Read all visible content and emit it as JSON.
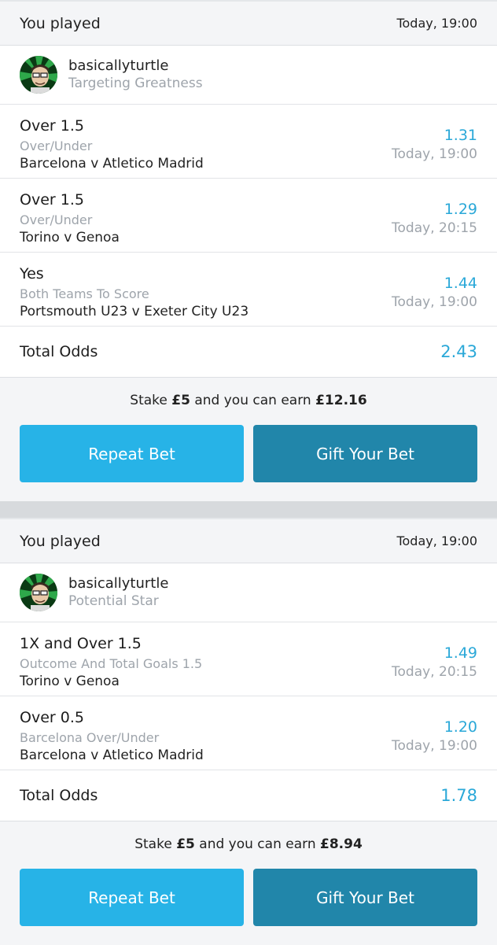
{
  "bets": [
    {
      "header": {
        "title": "You played",
        "time": "Today, 19:00"
      },
      "user": {
        "name": "basicallyturtle",
        "rank": "Targeting Greatness"
      },
      "selections": [
        {
          "pick": "Over 1.5",
          "market": "Over/Under",
          "event": "Barcelona v Atletico Madrid",
          "odds": "1.31",
          "time": "Today, 19:00"
        },
        {
          "pick": "Over 1.5",
          "market": "Over/Under",
          "event": "Torino v Genoa",
          "odds": "1.29",
          "time": "Today, 20:15"
        },
        {
          "pick": "Yes",
          "market": "Both Teams To Score",
          "event": "Portsmouth U23 v Exeter City U23",
          "odds": "1.44",
          "time": "Today, 19:00"
        }
      ],
      "total": {
        "label": "Total Odds",
        "value": "2.43"
      },
      "stake": {
        "prefix": "Stake",
        "amount": "£5",
        "middle": "and you can earn",
        "earn": "£12.16"
      },
      "buttons": {
        "repeat": "Repeat Bet",
        "gift": "Gift Your Bet"
      }
    },
    {
      "header": {
        "title": "You played",
        "time": "Today, 19:00"
      },
      "user": {
        "name": "basicallyturtle",
        "rank": "Potential Star"
      },
      "selections": [
        {
          "pick": "1X and Over 1.5",
          "market": "Outcome And Total Goals 1.5",
          "event": "Torino v Genoa",
          "odds": "1.49",
          "time": "Today, 20:15"
        },
        {
          "pick": "Over 0.5",
          "market": "Barcelona Over/Under",
          "event": "Barcelona v Atletico Madrid",
          "odds": "1.20",
          "time": "Today, 19:00"
        }
      ],
      "total": {
        "label": "Total Odds",
        "value": "1.78"
      },
      "stake": {
        "prefix": "Stake",
        "amount": "£5",
        "middle": "and you can earn",
        "earn": "£8.94"
      },
      "buttons": {
        "repeat": "Repeat Bet",
        "gift": "Gift Your Bet"
      }
    }
  ],
  "colors": {
    "accent": "#2aa8d8",
    "repeat_button": "#27b3e7",
    "gift_button": "#2186aa",
    "muted": "#9ea4ab"
  },
  "icons": {
    "avatar": "user-avatar-cartoon"
  }
}
